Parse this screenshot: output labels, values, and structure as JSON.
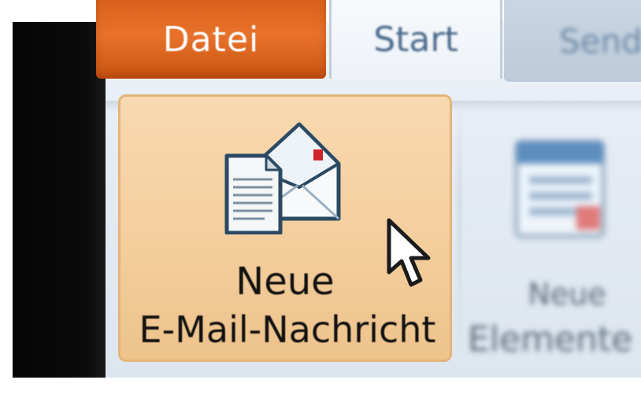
{
  "ribbon": {
    "tabs": [
      {
        "label": "Datei",
        "active": false,
        "color": "#e06a24"
      },
      {
        "label": "Start",
        "active": true
      },
      {
        "label": "Send",
        "active": false
      }
    ],
    "buttons": {
      "new_mail": {
        "line1": "Neue",
        "line2": "E-Mail-Nachricht",
        "icon": "new-email-icon",
        "highlight_color": "#f4cf9f"
      },
      "new_items": {
        "line1": "Neue",
        "line2": "Elemente",
        "icon": "new-items-icon"
      }
    }
  },
  "cursor": {
    "icon": "mouse-pointer-icon"
  }
}
